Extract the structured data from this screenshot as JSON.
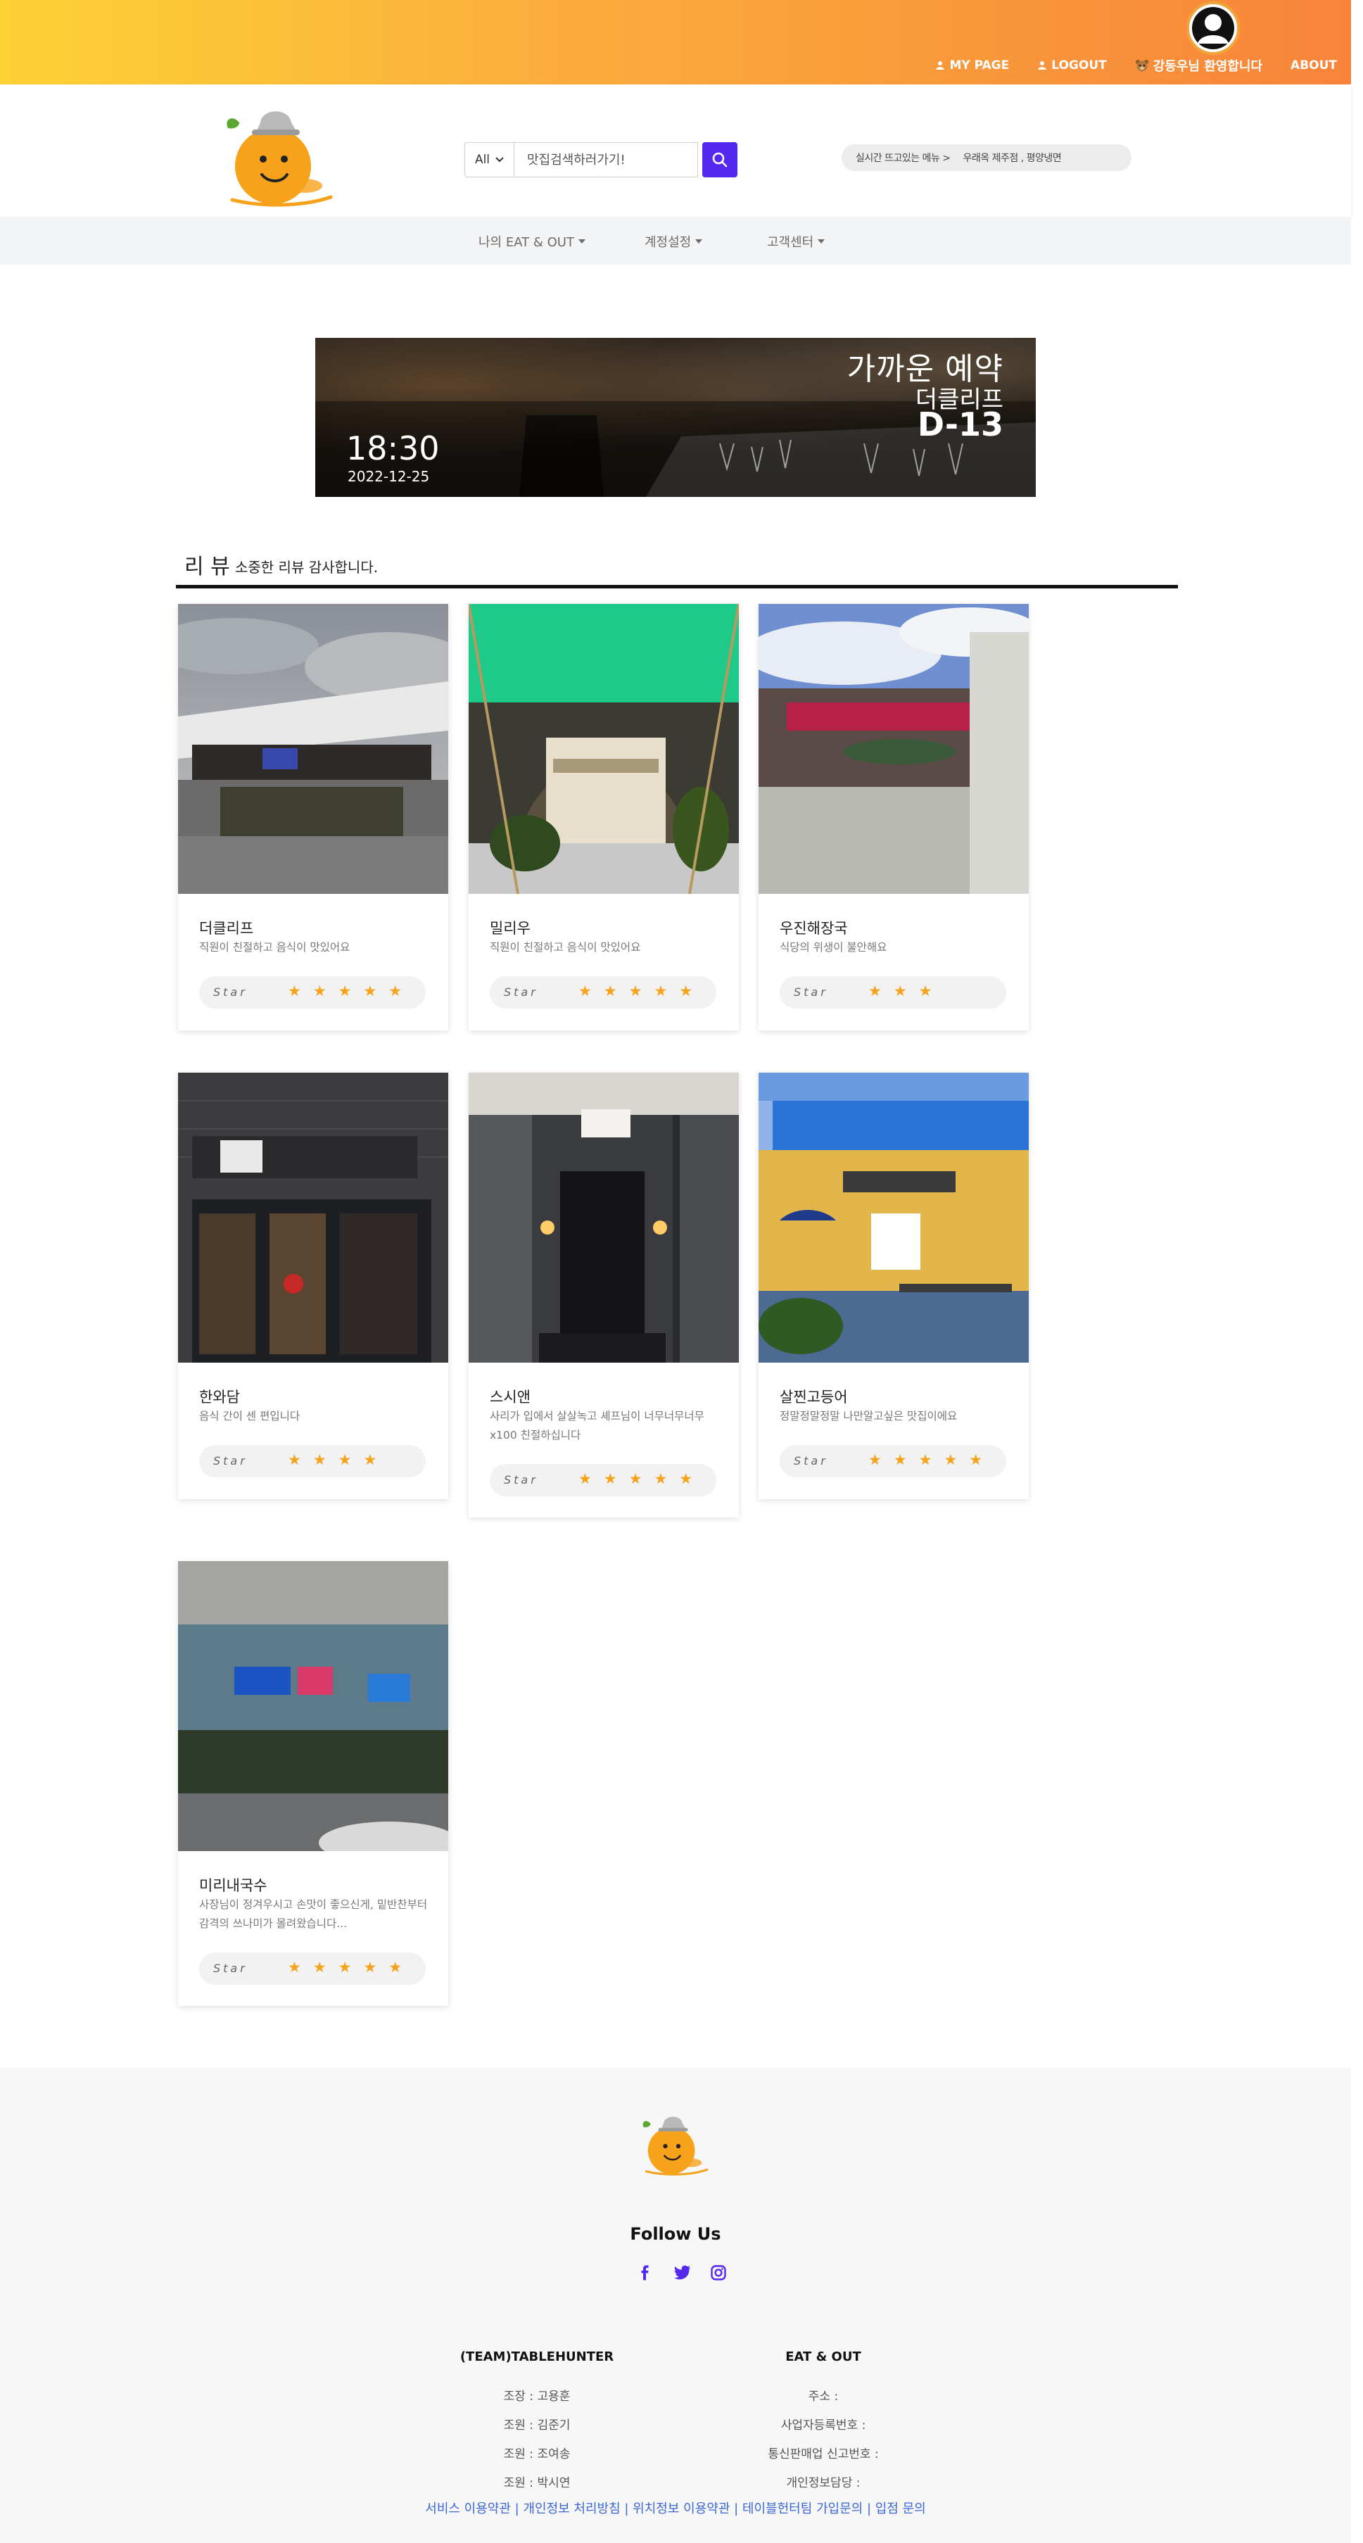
{
  "topnav": {
    "mypage": "MY PAGE",
    "logout": "LOGOUT",
    "welcome": "강동우님 환영합니다",
    "about": "ABOUT"
  },
  "header": {
    "search_select": "All",
    "search_placeholder": "맛집검색하러가기!",
    "trending_label": "실시간 뜨고있는 메뉴 >",
    "trending_value": "우래옥 제주점 , 평양냉면"
  },
  "menu": {
    "my_eatout": "나의 EAT & OUT",
    "account": "계정설정",
    "support": "고객센터"
  },
  "banner": {
    "title": "가까운 예약",
    "store": "더클리프",
    "dday": "D-13",
    "time": "18:30",
    "date": "2022-12-25"
  },
  "reviews": {
    "title": "리 뷰",
    "subtitle": "소중한 리뷰 감사합니다.",
    "star_label": "Star",
    "items": [
      {
        "name": "더클리프",
        "desc": "직원이 친절하고 음식이 맛있어요",
        "rating": 5,
        "stars": "★★★★★"
      },
      {
        "name": "밀리우",
        "desc": "직원이 친절하고 음식이 맛있어요",
        "rating": 5,
        "stars": "★★★★★"
      },
      {
        "name": "우진해장국",
        "desc": "식당의 위생이 불안해요",
        "rating": 3,
        "stars": "★★★"
      },
      {
        "name": "한와담",
        "desc": "음식 간이 센 편입니다",
        "rating": 4,
        "stars": "★★★★"
      },
      {
        "name": "스시앤",
        "desc": "사리가 입에서 살살녹고 셰프님이 너무너무너무 x100 친절하십니다",
        "rating": 5,
        "stars": "★★★★★"
      },
      {
        "name": "살찐고등어",
        "desc": "정말정말정말 나만알고싶은 맛집이에요",
        "rating": 5,
        "stars": "★★★★★"
      },
      {
        "name": "미리내국수",
        "desc": "사장님이 정겨우시고 손맛이 좋으신게, 밑반찬부터 감격의 쓰나미가 몰려왔습니다...",
        "rating": 5,
        "stars": "★★★★★"
      }
    ]
  },
  "footer": {
    "follow": "Follow Us",
    "team_title": "(TEAM)TABLEHUNTER",
    "team": [
      "조장 : 고용훈",
      "조원 : 김준기",
      "조원 : 조여송",
      "조원 : 박시연"
    ],
    "company_title": "EAT & OUT",
    "company": [
      "주소 :",
      "사업자등록번호 :",
      "통신판매업 신고번호 :",
      "개인정보담당 :"
    ],
    "links": [
      "서비스 이용약관",
      "개인정보 처리방침",
      "위치정보 이용약관",
      "테이블헌터팀 가입문의",
      "입점 문의"
    ],
    "link_sep": " | "
  },
  "colors": {
    "accent": "#5329f0",
    "star": "#f7a21b",
    "link": "#3b67d6",
    "gradient_start": "#fdd235",
    "gradient_end": "#f7843a"
  },
  "icons": [
    "user-icon",
    "search-icon",
    "chevron-down-icon",
    "facebook-icon",
    "twitter-icon",
    "instagram-icon",
    "bear-icon"
  ]
}
